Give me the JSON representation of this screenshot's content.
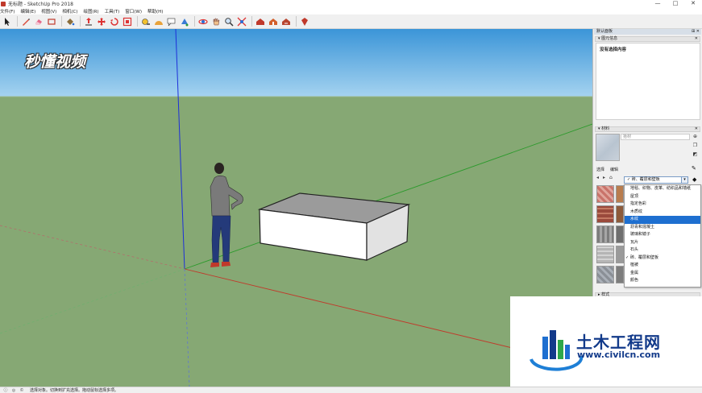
{
  "window": {
    "title": "无标题 - SketchUp Pro 2018",
    "controls": [
      "—",
      "□",
      "✕"
    ]
  },
  "menu": [
    "文件(F)",
    "编辑(E)",
    "视图(V)",
    "相机(C)",
    "绘图(R)",
    "工具(T)",
    "窗口(W)",
    "帮助(H)"
  ],
  "toolbar": {
    "buttons": [
      "select-tool",
      "pencil-line-tool",
      "eraser-tool",
      "shapes-tool",
      "paint-bucket-tool",
      "push-pull-tool",
      "move-tool",
      "rotate-tool",
      "offset-tool",
      "tape-measure-tool",
      "text-tool",
      "paint-tool",
      "orbit-tool",
      "pan-tool",
      "zoom-tool",
      "zoom-extents-tool",
      "warehouse-tool",
      "extension-tool",
      "share-tool",
      "ruby-tool"
    ]
  },
  "watermark_top_left": "秒懂视频",
  "tray": {
    "title": "默认面板",
    "entity_info": {
      "header": "▾ 图元信息",
      "content": "没有选择内容"
    },
    "materials": {
      "header": "▾ 材料",
      "name_placeholder": "拾材",
      "tabs": [
        "选择",
        "编辑"
      ],
      "selected_category": "砖、覆层和壁板",
      "categories": [
        {
          "label": "地毯、织物、皮革、纺织品和墙纸",
          "checked": false,
          "highlighted": false
        },
        {
          "label": "屋顶",
          "checked": false,
          "highlighted": false
        },
        {
          "label": "指定色彩",
          "checked": false,
          "highlighted": false
        },
        {
          "label": "木质纹",
          "checked": false,
          "highlighted": false
        },
        {
          "label": "水纹",
          "checked": false,
          "highlighted": true
        },
        {
          "label": "沥青和混凝土",
          "checked": false,
          "highlighted": false
        },
        {
          "label": "玻璃和镜子",
          "checked": false,
          "highlighted": false
        },
        {
          "label": "瓦片",
          "checked": false,
          "highlighted": false
        },
        {
          "label": "石头",
          "checked": false,
          "highlighted": false
        },
        {
          "label": "砖、覆层和壁板",
          "checked": true,
          "highlighted": false
        },
        {
          "label": "植被",
          "checked": false,
          "highlighted": false
        },
        {
          "label": "金属",
          "checked": false,
          "highlighted": false
        },
        {
          "label": "颜色",
          "checked": false,
          "highlighted": false
        }
      ]
    },
    "bottom_section_header": "▸ 样式"
  },
  "site_watermark": {
    "name": "土木工程网",
    "url": "www.civilcn.com"
  },
  "statusbar": {
    "icons": [
      "info-icon",
      "geo-icon",
      "credits-icon"
    ],
    "text": "选择对象。切换到扩充选择。拖动鼠标选择多项。"
  },
  "colors": {
    "sky": "#3b95d8",
    "ground": "#86a874",
    "accent_blue": "#1e6fd0",
    "site_blue": "#123a8a"
  }
}
